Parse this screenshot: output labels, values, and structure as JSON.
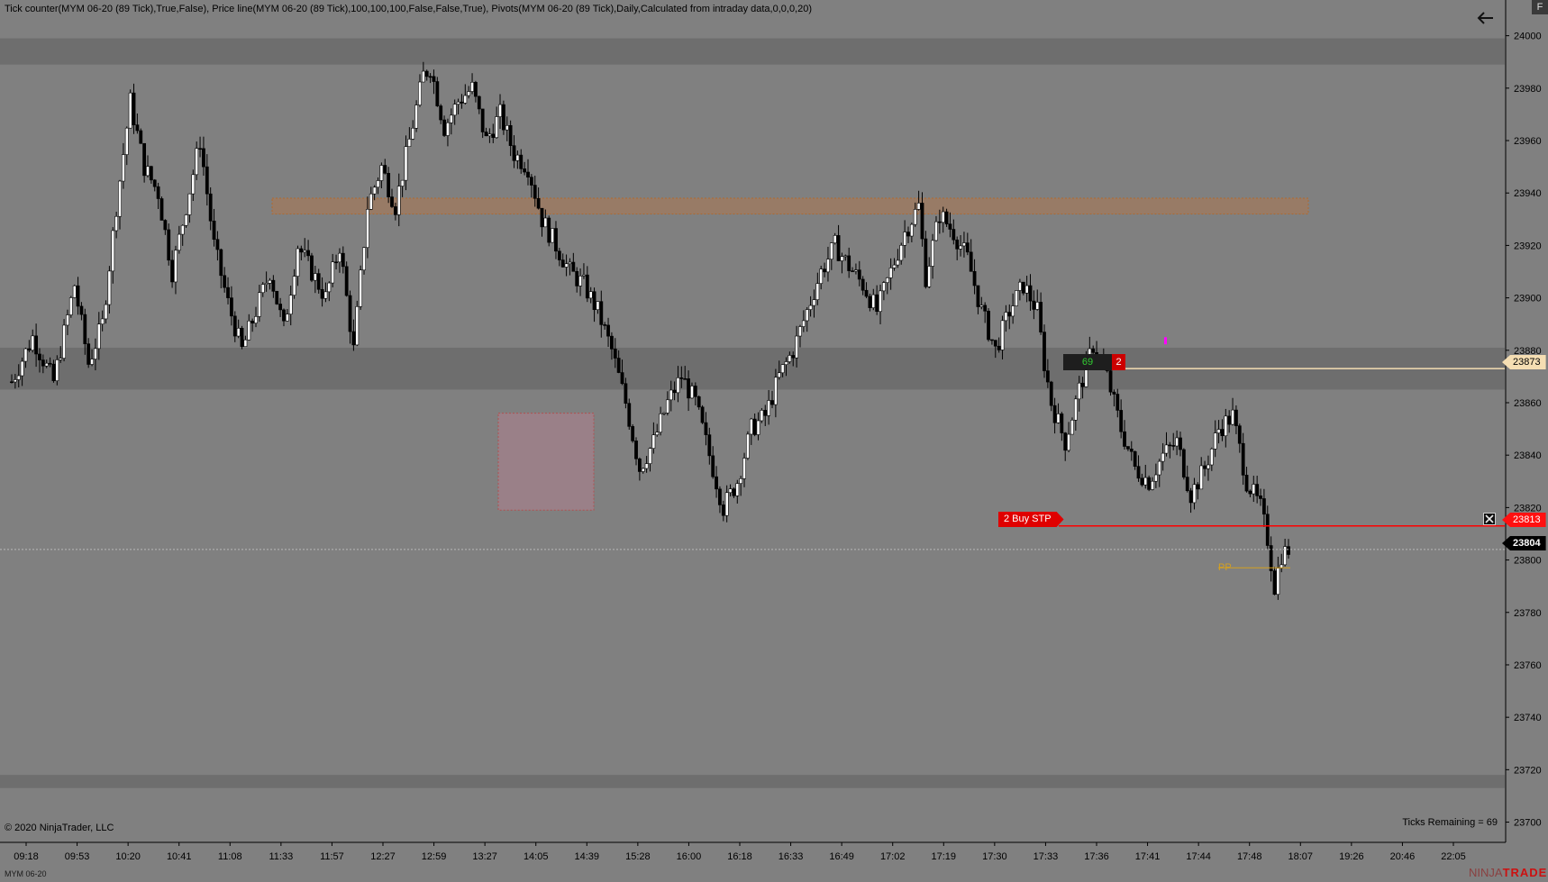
{
  "header": {
    "indicators": "Tick counter(MYM 06-20 (89 Tick),True,False), Price line(MYM 06-20 (89 Tick),100,100,100,False,False,True), Pivots(MYM 06-20 (89 Tick),Daily,Calculated from intraday data,0,0,0,20)"
  },
  "controls": {
    "back_icon": "arrow-left-icon",
    "f_label": "F"
  },
  "footer": {
    "copyright": "© 2020 NinjaTrader, LLC",
    "ticks_remaining": "Ticks Remaining = 69",
    "instrument": "MYM 06-20",
    "brand_prefix": "NINJA",
    "brand": "TRADER"
  },
  "order": {
    "label": "2  Buy STP",
    "price_tag": "23813"
  },
  "position": {
    "quantity": "69",
    "count": "2",
    "price_tag": "23873"
  },
  "last_price": "23804",
  "pivot_label": "PP",
  "colors": {
    "background": "#808080",
    "up_candle": "#ffffff",
    "down_candle": "#000000",
    "order_line": "#ff0000",
    "position_line": "#f5deb3",
    "zone_band": "#6e6e6e",
    "resistance_zone": "#a07a5e",
    "rect_zone": "#9a8088",
    "pivot": "#d4a020",
    "marker": "#ff00ff"
  },
  "chart_data": {
    "type": "candlestick",
    "instrument": "MYM 06-20",
    "timeframe": "89 Tick",
    "y_ticks": [
      24000,
      23980,
      23960,
      23940,
      23920,
      23900,
      23880,
      23860,
      23840,
      23820,
      23800,
      23780,
      23760,
      23740,
      23720,
      23700
    ],
    "x_ticks": [
      "09:18",
      "09:53",
      "10:20",
      "10:41",
      "11:08",
      "11:33",
      "11:57",
      "12:27",
      "12:59",
      "13:27",
      "14:05",
      "14:39",
      "15:28",
      "16:00",
      "16:18",
      "16:33",
      "16:49",
      "17:02",
      "17:19",
      "17:30",
      "17:33",
      "17:36",
      "17:41",
      "17:44",
      "17:48",
      "18:07",
      "19:26",
      "20:46",
      "22:05"
    ],
    "ylim": [
      23694,
      24004
    ],
    "price_path": [
      [
        0,
        23868
      ],
      [
        6,
        23885
      ],
      [
        12,
        23868
      ],
      [
        18,
        23905
      ],
      [
        22,
        23875
      ],
      [
        26,
        23890
      ],
      [
        30,
        23935
      ],
      [
        34,
        23975
      ],
      [
        38,
        23950
      ],
      [
        42,
        23940
      ],
      [
        46,
        23910
      ],
      [
        50,
        23935
      ],
      [
        54,
        23960
      ],
      [
        58,
        23920
      ],
      [
        62,
        23898
      ],
      [
        66,
        23880
      ],
      [
        70,
        23895
      ],
      [
        74,
        23910
      ],
      [
        78,
        23888
      ],
      [
        82,
        23920
      ],
      [
        86,
        23910
      ],
      [
        90,
        23900
      ],
      [
        94,
        23920
      ],
      [
        98,
        23880
      ],
      [
        102,
        23935
      ],
      [
        106,
        23950
      ],
      [
        110,
        23935
      ],
      [
        114,
        23960
      ],
      [
        118,
        23985
      ],
      [
        120,
        23988
      ],
      [
        124,
        23965
      ],
      [
        128,
        23975
      ],
      [
        132,
        23980
      ],
      [
        136,
        23960
      ],
      [
        140,
        23970
      ],
      [
        144,
        23955
      ],
      [
        148,
        23950
      ],
      [
        152,
        23930
      ],
      [
        156,
        23920
      ],
      [
        160,
        23910
      ],
      [
        164,
        23905
      ],
      [
        168,
        23895
      ],
      [
        172,
        23880
      ],
      [
        176,
        23860
      ],
      [
        180,
        23835
      ],
      [
        184,
        23845
      ],
      [
        188,
        23860
      ],
      [
        192,
        23870
      ],
      [
        196,
        23860
      ],
      [
        200,
        23840
      ],
      [
        204,
        23820
      ],
      [
        208,
        23830
      ],
      [
        212,
        23850
      ],
      [
        216,
        23855
      ],
      [
        220,
        23870
      ],
      [
        224,
        23880
      ],
      [
        228,
        23895
      ],
      [
        232,
        23910
      ],
      [
        236,
        23920
      ],
      [
        240,
        23912
      ],
      [
        244,
        23905
      ],
      [
        248,
        23895
      ],
      [
        252,
        23910
      ],
      [
        256,
        23925
      ],
      [
        260,
        23935
      ],
      [
        262,
        23908
      ],
      [
        266,
        23932
      ],
      [
        270,
        23925
      ],
      [
        274,
        23915
      ],
      [
        278,
        23895
      ],
      [
        282,
        23880
      ],
      [
        286,
        23895
      ],
      [
        290,
        23905
      ],
      [
        294,
        23895
      ],
      [
        296,
        23875
      ],
      [
        298,
        23860
      ],
      [
        302,
        23845
      ],
      [
        306,
        23865
      ],
      [
        310,
        23882
      ],
      [
        314,
        23870
      ],
      [
        318,
        23850
      ],
      [
        322,
        23835
      ],
      [
        326,
        23830
      ],
      [
        330,
        23840
      ],
      [
        334,
        23845
      ],
      [
        338,
        23825
      ],
      [
        342,
        23835
      ],
      [
        346,
        23850
      ],
      [
        350,
        23855
      ],
      [
        354,
        23830
      ],
      [
        358,
        23820
      ],
      [
        360,
        23808
      ],
      [
        362,
        23790
      ],
      [
        364,
        23802
      ],
      [
        366,
        23804
      ]
    ],
    "zones": [
      {
        "from": 23989,
        "to": 23999
      },
      {
        "from": 23865,
        "to": 23881
      },
      {
        "from": 23713,
        "to": 23718
      }
    ],
    "resistance_zone": {
      "from": 23932,
      "to": 23938
    },
    "rect_zone": {
      "from": 23819,
      "to": 23856
    },
    "pivot_pp": 23797,
    "position_price": 23873,
    "buy_stop_price": 23813,
    "last_price": 23804
  }
}
